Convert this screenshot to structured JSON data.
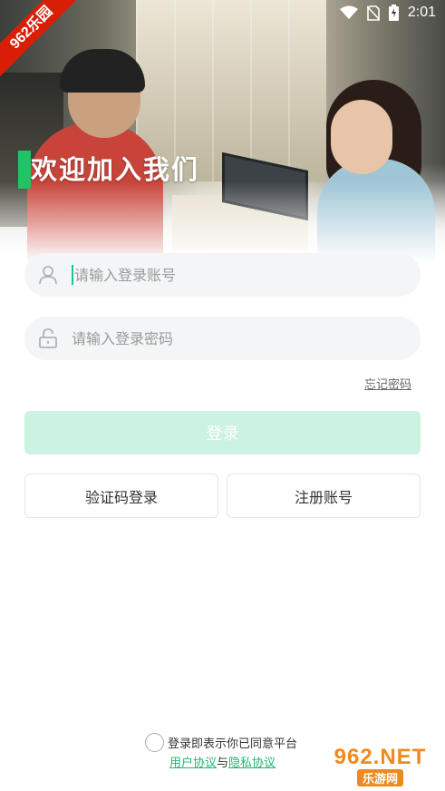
{
  "status_bar": {
    "time": "2:01"
  },
  "ribbon": {
    "text": "962乐园"
  },
  "hero": {
    "title": "欢迎加入我们"
  },
  "form": {
    "account_placeholder": "请输入登录账号",
    "password_placeholder": "请输入登录密码",
    "forgot_password": "忘记密码",
    "login_button": "登录",
    "sms_login_button": "验证码登录",
    "register_button": "注册账号"
  },
  "agreement": {
    "prefix": "登录即表示你已同意平台",
    "user_agreement": "用户协议",
    "connector": "与",
    "privacy_policy": "隐私协议"
  },
  "watermark": {
    "brand": "962.NET",
    "site": "乐游网"
  },
  "colors": {
    "accent": "#1db872",
    "login_button_bg": "#ccf2e1",
    "input_bg": "#f4f5f6"
  }
}
